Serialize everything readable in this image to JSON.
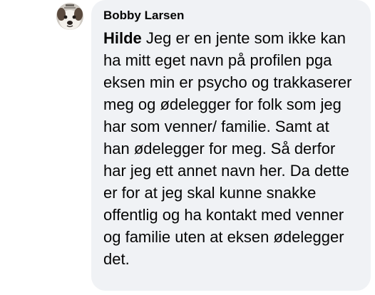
{
  "comment": {
    "avatar_icon": "profile-photo-dog",
    "author_name": "Bobby Larsen",
    "mention": "Hilde",
    "body": "Jeg er en jente som ikke kan ha mitt eget navn på profilen pga eksen min er psycho og trakkaserer meg og ødelegger for folk som jeg har som venner/ familie. Samt at han ødelegger for meg. Så derfor har jeg ett annet navn her. Da dette er for at jeg skal kunne snakke offentlig og ha kontakt med venner og familie uten at eksen ødelegger det.",
    "colors": {
      "bubble_bg": "#f0f2f5",
      "text": "#050505"
    }
  }
}
